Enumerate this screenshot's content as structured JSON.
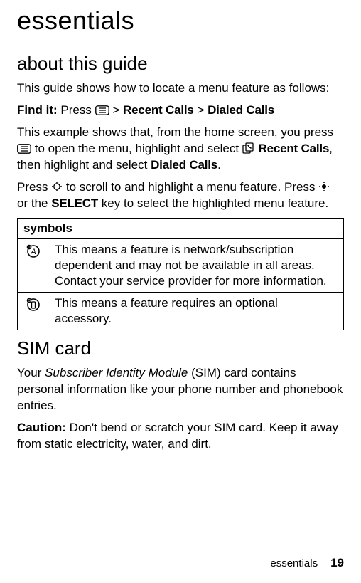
{
  "title": "essentials",
  "sections": {
    "about": {
      "heading": "about this guide",
      "intro": "This guide shows how to locate a menu feature as follows:",
      "findit_label": "Find it:",
      "findit_press": "Press",
      "gt1": ">",
      "menu_recent": "Recent Calls",
      "gt2": ">",
      "menu_dialed": "Dialed Calls",
      "example_a": "This example shows that, from the home screen, you press ",
      "example_b": " to open the menu, highlight and select ",
      "example_c": ", then highlight and select ",
      "example_c_dialed": "Dialed Calls",
      "example_d": ".",
      "press_a": "Press ",
      "press_b": " to scroll to and highlight a menu feature. Press ",
      "press_c": " or the ",
      "select_key": "SELECT",
      "press_d": " key to select the highlighted menu feature."
    },
    "symbols": {
      "header": "symbols",
      "row1": "This means a feature is network/subscription dependent and may not be available in all areas. Contact your service provider for more information.",
      "row2": "This means a feature requires an optional accessory."
    },
    "sim": {
      "heading": "SIM card",
      "p1a": "Your ",
      "p1b": "Subscriber Identity Module",
      "p1c": " (SIM) card contains personal information like your phone number and phonebook entries.",
      "caution_label": "Caution:",
      "caution_text": " Don't bend or scratch your SIM card. Keep it away from static electricity, water, and dirt."
    }
  },
  "icons": {
    "menu": "menu-key-icon",
    "recent": "recent-calls-icon",
    "nav": "nav-key-icon",
    "center": "center-key-icon",
    "network": "network-dependent-icon",
    "accessory": "accessory-required-icon"
  },
  "footer": {
    "label": "essentials",
    "page": "19"
  }
}
